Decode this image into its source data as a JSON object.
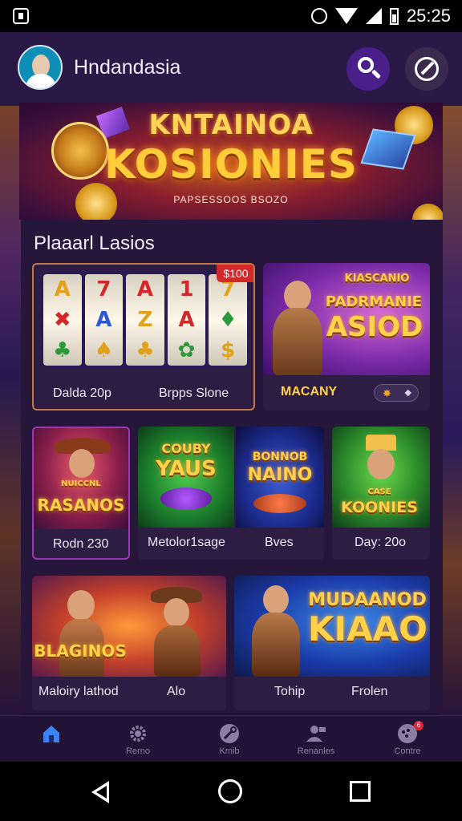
{
  "status_bar": {
    "time": "25:25"
  },
  "header": {
    "app_title": "Hndandasia"
  },
  "banner": {
    "line1": "KNTAINOA",
    "line2": "KOSIONIES",
    "subtitle": "PAPSESSOOS BSOZO"
  },
  "section": {
    "title": "Plaaarl Lasios"
  },
  "cards": [
    {
      "price_tag": "$100",
      "reel_symbols": [
        [
          "A",
          "✖",
          "♣"
        ],
        [
          "7",
          "A",
          "♠"
        ],
        [
          "A",
          "Z",
          "♣"
        ],
        [
          "1",
          "A",
          "✿"
        ],
        [
          "7",
          "♦",
          "$"
        ]
      ],
      "caption_left": "Dalda 20p",
      "caption_right": "Brpps Slone"
    },
    {
      "art_title_top": "KIASCANIO",
      "art_title_mid": "PADRMANIE",
      "art_title_main": "ASIOD",
      "caption": "MACANY"
    },
    {
      "art_title_top": "NUICCNL",
      "art_title_main": "RASANOS",
      "caption": "Rodn 230"
    },
    {
      "art_title_a": "COUBY",
      "art_title_b": "YAUS",
      "caption": "Metolor1sage"
    },
    {
      "art_title_a": "BONNOB",
      "art_title_b": "NAINO",
      "caption": "Bves"
    },
    {
      "art_title_top": "CASE",
      "art_title_main": "KOONIES",
      "caption": "Day: 20o"
    },
    {
      "art_title_main": "BLAGINOS",
      "caption_left": "Maloiry lathod",
      "caption_right": "Alo"
    },
    {
      "art_title_top": "MUDAANOD",
      "art_title_main": "KIAAO",
      "caption_left": "Tohip",
      "caption_right": "Frolen"
    }
  ],
  "bottom_nav": [
    {
      "label": "",
      "icon": "home-icon",
      "active": true
    },
    {
      "label": "Rerno",
      "icon": "gear-icon"
    },
    {
      "label": "Kmib",
      "icon": "wrench-icon"
    },
    {
      "label": "Renanles",
      "icon": "person-icon"
    },
    {
      "label": "Contre",
      "icon": "chat-icon",
      "badge": "6"
    }
  ],
  "colors": {
    "accent": "#4a1f8a",
    "background": "#1e1233",
    "gold": "#ffd24a",
    "nav_active": "#3b82f6"
  }
}
